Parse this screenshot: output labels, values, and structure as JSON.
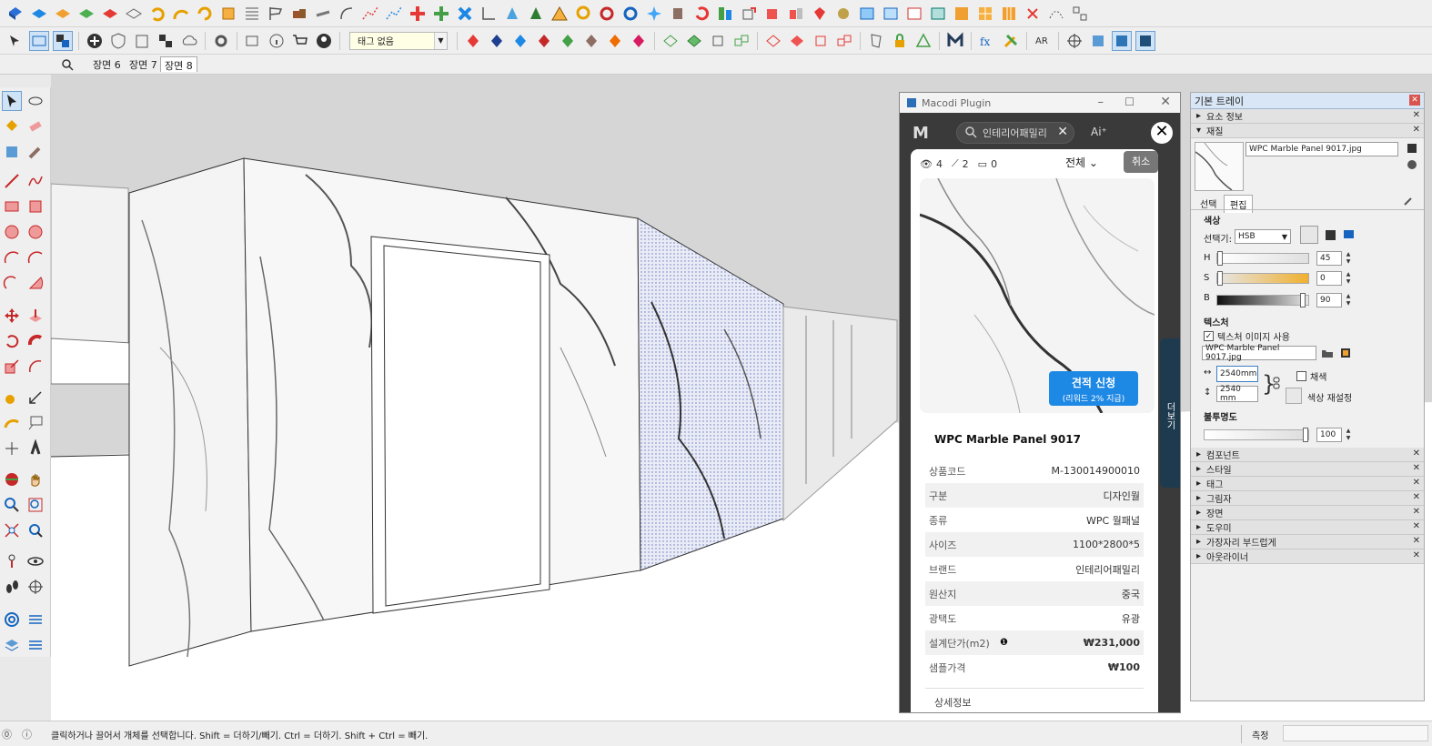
{
  "toolbar": {
    "tag_select": "태그 없음"
  },
  "scenes": {
    "search_icon": "search-icon",
    "tabs": [
      "장면 6",
      "장면 7",
      "장면 8"
    ]
  },
  "plugin": {
    "title": "Macodi Plugin",
    "logo": "M",
    "search_value": "인테리어패밀리",
    "ai_label": "Ai⁺",
    "side_tab": "더보기",
    "stats": {
      "views": "4",
      "links": "2",
      "saves": "0"
    },
    "filter_label": "전체",
    "cancel_label": "취소",
    "quote_button": "견적 신청",
    "quote_sub": "(리워드 2% 지급)",
    "product_name": "WPC Marble Panel 9017",
    "specs": [
      {
        "key": "상품코드",
        "value": "M-130014900010"
      },
      {
        "key": "구분",
        "value": "디자인월"
      },
      {
        "key": "종류",
        "value": "WPC 월패널"
      },
      {
        "key": "사이즈",
        "value": "1100*2800*5"
      },
      {
        "key": "브랜드",
        "value": "인테리어패밀리"
      },
      {
        "key": "원산지",
        "value": "중국"
      },
      {
        "key": "광택도",
        "value": "유광"
      },
      {
        "key": "설계단가(m2)",
        "value": "₩231,000"
      },
      {
        "key": "샘플가격",
        "value": "₩100"
      }
    ],
    "detail_label": "상세정보"
  },
  "tray": {
    "title": "기본 트레이",
    "entity_info": "요소 정보",
    "materials": "재질",
    "material_name": "WPC Marble Panel 9017.jpg",
    "tab_select": "선택",
    "tab_edit": "편집",
    "color_heading": "색상",
    "picker_label": "선택기:",
    "picker_value": "HSB",
    "h_label": "H",
    "h_value": "45",
    "s_label": "S",
    "s_value": "0",
    "b_label": "B",
    "b_value": "90",
    "texture_heading": "텍스처",
    "use_texture": "텍스처 이미지 사용",
    "texture_file": "WPC Marble Panel 9017.jpg",
    "width_value": "2540mm",
    "height_value": "2540 mm",
    "colorize": "채색",
    "reset_color": "색상 재설정",
    "opacity_heading": "불투명도",
    "opacity_value": "100",
    "panels": [
      "컴포넌트",
      "스타일",
      "태그",
      "그림자",
      "장면",
      "도우미",
      "가장자리 부드럽게",
      "아웃라이너"
    ]
  },
  "status": {
    "message": "클릭하거나 끌어서 개체를 선택합니다. Shift = 더하기/빼기. Ctrl = 더하기. Shift + Ctrl = 빼기.",
    "measure_label": "측정"
  }
}
